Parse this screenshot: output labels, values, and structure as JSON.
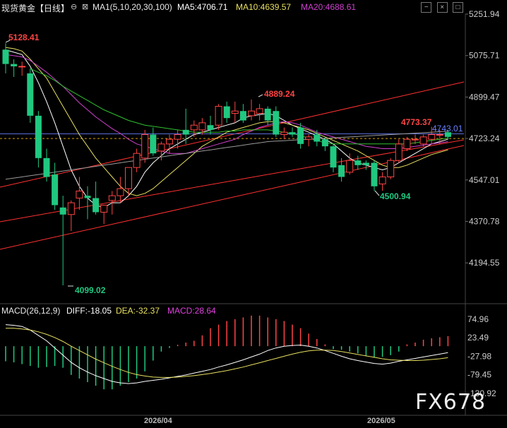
{
  "header": {
    "symbol": "现货黄金【日线】",
    "ma_title": "MA1(5,10,20,30,100)",
    "ma5": "MA5:4706.71",
    "ma10": "MA10:4639.57",
    "ma20": "MA20:4688.61"
  },
  "macd_header": {
    "title": "MACD(26,12,9)",
    "diff": "DIFF:-18.05",
    "dea": "DEA:-32.37",
    "macd": "MACD:28.64"
  },
  "colors": {
    "up": "#ff4444",
    "down": "#20c880",
    "ma5": "#ffffff",
    "ma10": "#e8e060",
    "ma20": "#d040d0",
    "ma30": "#30c030",
    "ma100": "#9a9a9a",
    "channel": "#ff3030",
    "hline": "#5a6cd8",
    "lastprice": "#d8a000"
  },
  "price_axis": [
    "5251.94",
    "5075.71",
    "4899.47",
    "4723.24",
    "4547.01",
    "4370.78",
    "4194.55"
  ],
  "macd_axis": [
    "74.96",
    "23.49",
    "-27.98",
    "-79.45",
    "-130.92"
  ],
  "x_axis": [
    "2026/04",
    "2026/05"
  ],
  "annotations": {
    "high": "5128.41",
    "low": "4099.02",
    "peak1": "4889.24",
    "peak2": "4773.37",
    "trough2": "4500.94",
    "hline_value": "4743.01"
  },
  "watermark": "FX678",
  "chart_data": {
    "type": "candlestick",
    "title": "现货黄金【日线】",
    "ylim": [
      4099.02,
      5251.94
    ],
    "candles": [
      [
        5101,
        5128,
        5000,
        5040
      ],
      [
        5040,
        5060,
        4985,
        5030
      ],
      [
        5030,
        5050,
        4990,
        5030
      ],
      [
        5000,
        5020,
        4790,
        4820
      ],
      [
        4820,
        4840,
        4600,
        4640
      ],
      [
        4640,
        4680,
        4540,
        4560
      ],
      [
        4570,
        4620,
        4420,
        4440
      ],
      [
        4430,
        4480,
        4099,
        4400
      ],
      [
        4400,
        4460,
        4330,
        4450
      ],
      [
        4470,
        4560,
        4420,
        4500
      ],
      [
        4480,
        4520,
        4380,
        4470
      ],
      [
        4470,
        4540,
        4400,
        4410
      ],
      [
        4410,
        4440,
        4360,
        4440
      ],
      [
        4460,
        4500,
        4400,
        4480
      ],
      [
        4480,
        4560,
        4450,
        4510
      ],
      [
        4510,
        4600,
        4480,
        4600
      ],
      [
        4600,
        4680,
        4580,
        4660
      ],
      [
        4640,
        4760,
        4620,
        4740
      ],
      [
        4740,
        4770,
        4650,
        4660
      ],
      [
        4670,
        4710,
        4630,
        4700
      ],
      [
        4700,
        4740,
        4660,
        4720
      ],
      [
        4720,
        4760,
        4680,
        4740
      ],
      [
        4760,
        4850,
        4700,
        4740
      ],
      [
        4760,
        4800,
        4730,
        4780
      ],
      [
        4760,
        4810,
        4740,
        4790
      ],
      [
        4780,
        4820,
        4740,
        4760
      ],
      [
        4780,
        4870,
        4760,
        4860
      ],
      [
        4860,
        4880,
        4790,
        4810
      ],
      [
        4830,
        4880,
        4790,
        4840
      ],
      [
        4840,
        4870,
        4790,
        4800
      ],
      [
        4820,
        4889,
        4800,
        4840
      ],
      [
        4830,
        4870,
        4800,
        4850
      ],
      [
        4850,
        4860,
        4780,
        4800
      ],
      [
        4840,
        4860,
        4730,
        4740
      ],
      [
        4740,
        4770,
        4720,
        4750
      ],
      [
        4750,
        4770,
        4730,
        4740
      ],
      [
        4770,
        4790,
        4680,
        4700
      ],
      [
        4720,
        4740,
        4690,
        4730
      ],
      [
        4740,
        4760,
        4690,
        4710
      ],
      [
        4720,
        4730,
        4670,
        4690
      ],
      [
        4690,
        4700,
        4580,
        4600
      ],
      [
        4610,
        4640,
        4540,
        4560
      ],
      [
        4580,
        4660,
        4570,
        4630
      ],
      [
        4630,
        4650,
        4590,
        4610
      ],
      [
        4620,
        4630,
        4590,
        4610
      ],
      [
        4620,
        4630,
        4500,
        4520
      ],
      [
        4530,
        4580,
        4501,
        4560
      ],
      [
        4560,
        4640,
        4550,
        4630
      ],
      [
        4630,
        4720,
        4620,
        4700
      ],
      [
        4680,
        4730,
        4670,
        4720
      ],
      [
        4720,
        4740,
        4700,
        4720
      ],
      [
        4700,
        4740,
        4690,
        4730
      ],
      [
        4720,
        4773,
        4700,
        4740
      ],
      [
        4740,
        4760,
        4700,
        4740
      ],
      [
        4750,
        4760,
        4720,
        4730
      ]
    ],
    "series": [
      {
        "name": "MA5",
        "values": [
          5100,
          5090,
          5080,
          5030,
          4960,
          4880,
          4790,
          4690,
          4590,
          4520,
          4470,
          4440,
          4430,
          4450,
          4450,
          4480,
          4520,
          4580,
          4620,
          4650,
          4680,
          4700,
          4720,
          4740,
          4750,
          4760,
          4770,
          4780,
          4790,
          4810,
          4820,
          4825,
          4830,
          4820,
          4800,
          4780,
          4765,
          4750,
          4735,
          4720,
          4700,
          4670,
          4640,
          4620,
          4610,
          4600,
          4590,
          4600,
          4620,
          4640,
          4660,
          4680,
          4700,
          4710,
          4720
        ]
      },
      {
        "name": "MA10",
        "values": [
          5110,
          5105,
          5095,
          5060,
          5020,
          4980,
          4920,
          4860,
          4800,
          4740,
          4690,
          4640,
          4600,
          4560,
          4520,
          4490,
          4480,
          4490,
          4510,
          4540,
          4570,
          4600,
          4630,
          4660,
          4690,
          4710,
          4730,
          4750,
          4760,
          4770,
          4780,
          4790,
          4795,
          4795,
          4790,
          4780,
          4770,
          4760,
          4745,
          4730,
          4715,
          4700,
          4685,
          4670,
          4650,
          4630,
          4610,
          4600,
          4600,
          4610,
          4625,
          4640,
          4655,
          4665,
          4675
        ]
      },
      {
        "name": "MA20",
        "values": [
          5080,
          5075,
          5070,
          5055,
          5030,
          5005,
          4975,
          4945,
          4910,
          4875,
          4845,
          4815,
          4790,
          4765,
          4745,
          4720,
          4700,
          4690,
          4680,
          4670,
          4660,
          4660,
          4660,
          4670,
          4680,
          4690,
          4700,
          4710,
          4720,
          4740,
          4755,
          4770,
          4780,
          4790,
          4795,
          4790,
          4780,
          4765,
          4750,
          4740,
          4730,
          4720,
          4710,
          4700,
          4690,
          4685,
          4680,
          4680,
          4680,
          4685,
          4690,
          4695,
          4700,
          4705,
          4710
        ]
      },
      {
        "name": "MA30",
        "values": [
          null,
          null,
          null,
          5020,
          5005,
          4990,
          4970,
          4945,
          4925,
          4905,
          4885,
          4865,
          4845,
          4830,
          4815,
          4800,
          4790,
          4780,
          4775,
          4770,
          4765,
          4760,
          4755,
          4750,
          4750,
          4750,
          4750,
          4755,
          4755,
          4760,
          4760,
          4760,
          4760,
          4755,
          4750,
          4745,
          4735,
          4725,
          4715,
          4705,
          4700,
          4700,
          4700,
          4700,
          4700,
          4700,
          4700,
          4700,
          4700,
          4700,
          4705,
          4710,
          4715,
          4720,
          4725
        ]
      },
      {
        "name": "MA100",
        "values": [
          4550,
          4555,
          4560,
          4565,
          4570,
          4575,
          4580,
          4585,
          4590,
          4595,
          4600,
          4605,
          4610,
          4615,
          4620,
          4625,
          4630,
          4635,
          4640,
          4645,
          4650,
          4655,
          4660,
          4665,
          4670,
          4675,
          4680,
          4685,
          4690,
          4695,
          4700,
          4705,
          4710,
          4712,
          4714,
          4716,
          4718,
          4720,
          4722,
          4724,
          4726,
          4728,
          4730,
          4732,
          4734,
          4736,
          4738,
          4740,
          4742,
          4744,
          4746,
          4748,
          4750,
          4752,
          4754
        ]
      }
    ],
    "macd": {
      "dif": [
        60,
        58,
        55,
        45,
        30,
        15,
        -5,
        -25,
        -45,
        -60,
        -72,
        -82,
        -90,
        -98,
        -102,
        -104,
        -102,
        -98,
        -95,
        -92,
        -88,
        -84,
        -80,
        -75,
        -70,
        -65,
        -58,
        -52,
        -45,
        -38,
        -30,
        -22,
        -12,
        -5,
        0,
        2,
        3,
        0,
        -5,
        -12,
        -20,
        -28,
        -35,
        -40,
        -44,
        -48,
        -50,
        -47,
        -42,
        -38,
        -34,
        -30,
        -26,
        -22,
        -18
      ],
      "dea": [
        50,
        50,
        48,
        45,
        40,
        33,
        24,
        13,
        0,
        -12,
        -24,
        -36,
        -46,
        -56,
        -65,
        -73,
        -79,
        -83,
        -86,
        -87,
        -87,
        -86,
        -84,
        -82,
        -79,
        -76,
        -72,
        -68,
        -63,
        -58,
        -52,
        -46,
        -40,
        -34,
        -28,
        -22,
        -17,
        -13,
        -11,
        -11,
        -12,
        -15,
        -19,
        -23,
        -27,
        -31,
        -35,
        -38,
        -39,
        -40,
        -40,
        -39,
        -37,
        -35,
        -32
      ],
      "hist": [
        -42,
        -45,
        -50,
        -55,
        -60,
        -58,
        -55,
        -60,
        -80,
        -90,
        -100,
        -110,
        -120,
        -120,
        -110,
        -100,
        -90,
        -70,
        -40,
        -15,
        -5,
        4,
        10,
        15,
        30,
        50,
        60,
        70,
        75,
        80,
        85,
        85,
        80,
        75,
        70,
        60,
        50,
        35,
        20,
        5,
        -8,
        -10,
        -15,
        -20,
        -28,
        -32,
        -30,
        -25,
        -15,
        5,
        10,
        18,
        22,
        25,
        28
      ]
    }
  }
}
